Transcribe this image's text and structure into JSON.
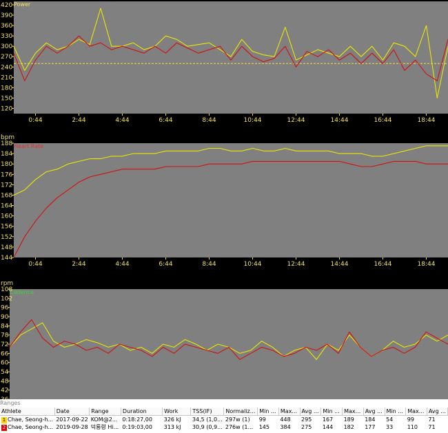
{
  "chart_data": [
    {
      "type": "line",
      "title": "Power",
      "ylabel": "Power",
      "ylim": [
        105,
        430
      ],
      "yticks": [
        120,
        150,
        180,
        210,
        240,
        270,
        300,
        330,
        360,
        390,
        420
      ],
      "xlim": [
        0,
        40
      ],
      "xticks": [
        "0:44",
        "2:44",
        "4:44",
        "6:44",
        "8:44",
        "10:44",
        "12:44",
        "14:44",
        "16:44",
        "18:44"
      ],
      "xtick_values": [
        2,
        6,
        10,
        14,
        18,
        22,
        26,
        30,
        34,
        38
      ],
      "reference_line": 250,
      "series": [
        {
          "color": "#e8e800",
          "x": [
            0,
            1,
            2,
            3,
            4,
            5,
            6,
            7,
            8,
            9,
            10,
            11,
            12,
            13,
            14,
            15,
            16,
            17,
            18,
            19,
            20,
            21,
            22,
            23,
            24,
            25,
            26,
            27,
            28,
            29,
            30,
            31,
            32,
            33,
            34,
            35,
            36,
            37,
            38,
            39,
            40
          ],
          "values": [
            300,
            230,
            280,
            310,
            290,
            300,
            320,
            305,
            410,
            300,
            300,
            310,
            290,
            300,
            330,
            320,
            300,
            305,
            310,
            290,
            270,
            320,
            285,
            275,
            270,
            355,
            260,
            275,
            290,
            280,
            270,
            300,
            270,
            300,
            260,
            310,
            300,
            270,
            360,
            150,
            300
          ]
        },
        {
          "color": "#d01010",
          "x": [
            0,
            1,
            2,
            3,
            4,
            5,
            6,
            7,
            8,
            9,
            10,
            11,
            12,
            13,
            14,
            15,
            16,
            17,
            18,
            19,
            20,
            21,
            22,
            23,
            24,
            25,
            26,
            27,
            28,
            29,
            30,
            31,
            32,
            33,
            34,
            35,
            36,
            37,
            38,
            39,
            40
          ],
          "values": [
            280,
            200,
            260,
            300,
            280,
            300,
            330,
            300,
            310,
            290,
            300,
            290,
            280,
            300,
            280,
            310,
            295,
            280,
            290,
            300,
            260,
            300,
            270,
            255,
            265,
            300,
            240,
            285,
            270,
            290,
            260,
            280,
            250,
            280,
            250,
            290,
            230,
            260,
            220,
            200,
            320
          ]
        }
      ]
    },
    {
      "type": "line",
      "title": "Heart Rate",
      "ylabel": "bpm",
      "ylim": [
        144,
        188
      ],
      "yticks": [
        144,
        148,
        152,
        156,
        160,
        164,
        168,
        172,
        176,
        180,
        184,
        188
      ],
      "xlim": [
        0,
        40
      ],
      "xticks": [
        "0:44",
        "2:44",
        "4:44",
        "6:44",
        "8:44",
        "10:44",
        "12:44",
        "14:44",
        "16:44",
        "18:44"
      ],
      "xtick_values": [
        2,
        6,
        10,
        14,
        18,
        22,
        26,
        30,
        34,
        38
      ],
      "series": [
        {
          "color": "#e8e800",
          "x": [
            0,
            1,
            2,
            3,
            4,
            5,
            6,
            7,
            8,
            9,
            10,
            11,
            12,
            13,
            14,
            15,
            16,
            17,
            18,
            19,
            20,
            21,
            22,
            23,
            24,
            25,
            26,
            27,
            28,
            29,
            30,
            31,
            32,
            33,
            34,
            35,
            36,
            37,
            38,
            39,
            40
          ],
          "values": [
            168,
            170,
            174,
            177,
            178,
            180,
            181,
            182,
            182,
            183,
            183,
            184,
            184,
            184,
            185,
            185,
            185,
            185,
            186,
            186,
            185,
            185,
            186,
            185,
            185,
            186,
            185,
            185,
            185,
            185,
            184,
            184,
            184,
            183,
            183,
            184,
            185,
            186,
            187,
            187,
            187
          ]
        },
        {
          "color": "#d01010",
          "x": [
            0,
            1,
            2,
            3,
            4,
            5,
            6,
            7,
            8,
            9,
            10,
            11,
            12,
            13,
            14,
            15,
            16,
            17,
            18,
            19,
            20,
            21,
            22,
            23,
            24,
            25,
            26,
            27,
            28,
            29,
            30,
            31,
            32,
            33,
            34,
            35,
            36,
            37,
            38,
            39,
            40
          ],
          "values": [
            144,
            152,
            158,
            163,
            167,
            170,
            173,
            175,
            176,
            177,
            178,
            178,
            178,
            178,
            179,
            179,
            179,
            179,
            180,
            180,
            180,
            180,
            181,
            181,
            181,
            181,
            181,
            181,
            181,
            181,
            181,
            180,
            179,
            179,
            180,
            181,
            181,
            181,
            180,
            180,
            180
          ]
        }
      ]
    },
    {
      "type": "line",
      "title": "Cadence",
      "ylabel": "rpm",
      "ylim": [
        36,
        108
      ],
      "yticks": [
        36,
        42,
        48,
        54,
        60,
        66,
        72,
        78,
        84,
        90,
        96,
        102,
        108
      ],
      "xlim": [
        0,
        40
      ],
      "series": [
        {
          "color": "#e8e800",
          "x": [
            0,
            1,
            2,
            3,
            4,
            5,
            6,
            7,
            8,
            9,
            10,
            11,
            12,
            13,
            14,
            15,
            16,
            17,
            18,
            19,
            20,
            21,
            22,
            23,
            24,
            25,
            26,
            27,
            28,
            29,
            30,
            31,
            32,
            33,
            34,
            35,
            36,
            37,
            38,
            39,
            40
          ],
          "values": [
            70,
            78,
            82,
            86,
            74,
            70,
            72,
            75,
            73,
            70,
            72,
            68,
            70,
            66,
            72,
            70,
            75,
            72,
            68,
            72,
            70,
            66,
            68,
            74,
            70,
            64,
            68,
            70,
            62,
            72,
            68,
            78,
            70,
            64,
            68,
            74,
            70,
            72,
            78,
            74,
            78
          ]
        },
        {
          "color": "#d01010",
          "x": [
            0,
            1,
            2,
            3,
            4,
            5,
            6,
            7,
            8,
            9,
            10,
            11,
            12,
            13,
            14,
            15,
            16,
            17,
            18,
            19,
            20,
            21,
            22,
            23,
            24,
            25,
            26,
            27,
            28,
            29,
            30,
            31,
            32,
            33,
            34,
            35,
            36,
            37,
            38,
            39,
            40
          ],
          "values": [
            70,
            80,
            88,
            76,
            70,
            74,
            72,
            68,
            70,
            66,
            72,
            70,
            68,
            64,
            70,
            66,
            72,
            70,
            68,
            66,
            70,
            62,
            66,
            70,
            68,
            64,
            66,
            70,
            68,
            72,
            66,
            80,
            70,
            64,
            68,
            70,
            66,
            70,
            80,
            76,
            72
          ]
        }
      ]
    }
  ],
  "panels": {
    "power": {
      "label": "Power"
    },
    "hr": {
      "unit": "bpm",
      "label": "Heart Rate"
    },
    "cadence": {
      "unit": "rpm",
      "label": "Cadence"
    }
  },
  "ranges": {
    "title": "Ranges",
    "columns": [
      "Athlete",
      "Date",
      "Range",
      "Duration",
      "Work",
      "TSS(IF)",
      "Normaliz...",
      "Min ...",
      "Max...",
      "Avg ...",
      "Min ...",
      "Max...",
      "Avg ...",
      "Min ...",
      "Max...",
      "Avg ..."
    ],
    "rows": [
      {
        "index": "1",
        "cells": [
          "Chae, Seong-h...",
          "2017-09-22",
          "KOM@2...",
          "0:18:27,00",
          "326 kJ",
          "34,5 (1,0...",
          "297w (1)",
          "99",
          "448",
          "295",
          "167",
          "189",
          "184",
          "54",
          "99",
          "71"
        ]
      },
      {
        "index": "2",
        "cells": [
          "Chae, Seong-h...",
          "2019-09-28",
          "덕룡령 Hi...",
          "0:19:03,00",
          "313 kJ",
          "30,9 (0,9...",
          "276w (1...",
          "145",
          "384",
          "275",
          "144",
          "182",
          "177",
          "33",
          "110",
          "71"
        ]
      }
    ]
  },
  "colors": {
    "panel_bg": "#808080",
    "axis_text": "#f0e060",
    "grid": "#a0a0a0",
    "power_ref": "#ffe040",
    "cad_label": "#40d040",
    "hr_label": "#e03030"
  }
}
